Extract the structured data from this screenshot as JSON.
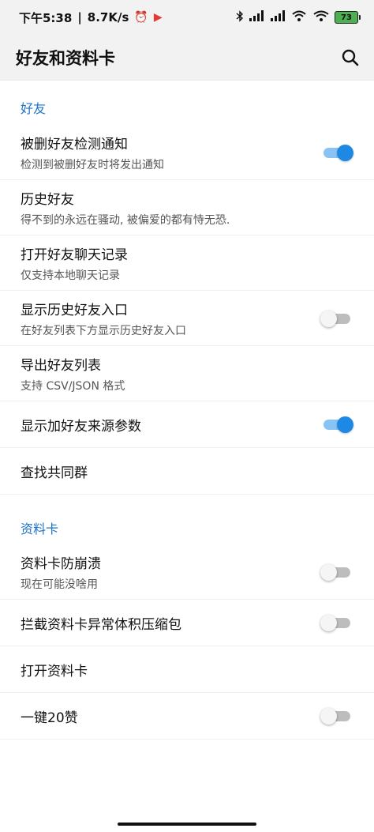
{
  "status_bar": {
    "time": "下午5:38",
    "speed": "8.7K/s",
    "battery": "73"
  },
  "app_bar": {
    "title": "好友和资料卡",
    "search_icon": "search-icon"
  },
  "sections": [
    {
      "header": "好友",
      "items": [
        {
          "title": "被删好友检测通知",
          "subtitle": "检测到被删好友时将发出通知",
          "toggle": true
        },
        {
          "title": "历史好友",
          "subtitle": "得不到的永远在骚动, 被偏爱的都有恃无恐.",
          "toggle": null
        },
        {
          "title": "打开好友聊天记录",
          "subtitle": "仅支持本地聊天记录",
          "toggle": null
        },
        {
          "title": "显示历史好友入口",
          "subtitle": "在好友列表下方显示历史好友入口",
          "toggle": false
        },
        {
          "title": "导出好友列表",
          "subtitle": "支持 CSV/JSON 格式",
          "toggle": null
        },
        {
          "title": "显示加好友来源参数",
          "subtitle": "",
          "toggle": true
        },
        {
          "title": "查找共同群",
          "subtitle": "",
          "toggle": null
        }
      ]
    },
    {
      "header": "资料卡",
      "items": [
        {
          "title": "资料卡防崩溃",
          "subtitle": "现在可能没啥用",
          "toggle": false
        },
        {
          "title": "拦截资料卡异常体积压缩包",
          "subtitle": "",
          "toggle": false
        },
        {
          "title": "打开资料卡",
          "subtitle": "",
          "toggle": null
        },
        {
          "title": "一键20赞",
          "subtitle": "",
          "toggle": false
        }
      ]
    }
  ],
  "colors": {
    "accent": "#1e88e5",
    "section_header": "#1a73c9"
  }
}
